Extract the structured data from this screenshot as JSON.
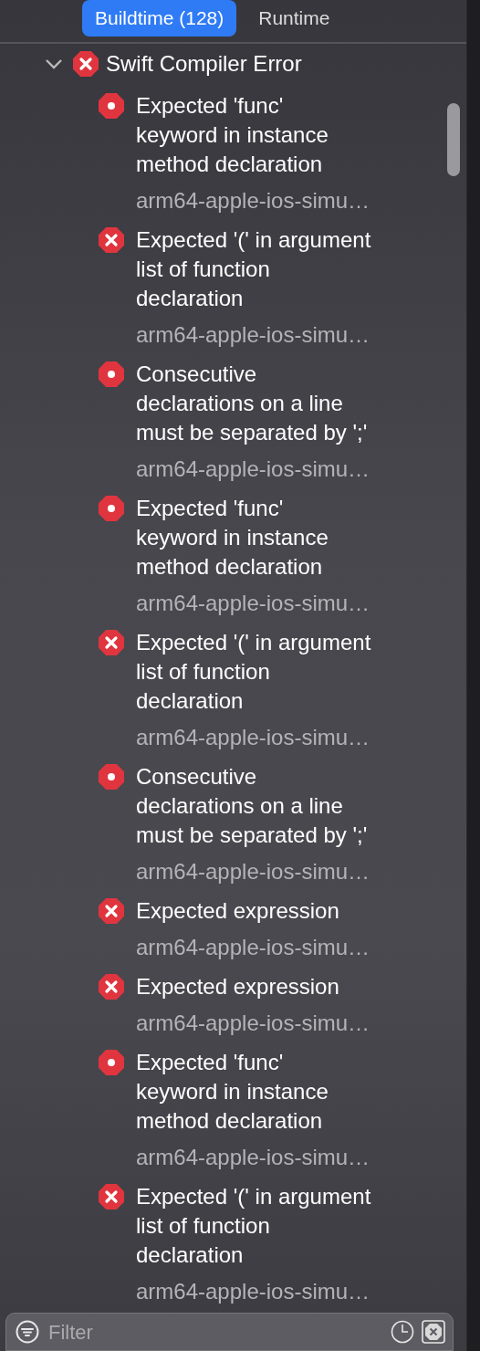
{
  "tabs": [
    {
      "label": "Buildtime (128)",
      "selected": true
    },
    {
      "label": "Runtime",
      "selected": false
    }
  ],
  "tree": {
    "label": "Swift Compiler Error",
    "kind": "x",
    "expanded": true,
    "children": [
      {
        "kind": "dot",
        "title_lines": [
          "Expected 'func'",
          "keyword in instance",
          "method declaration"
        ],
        "subtitle": "arm64-apple-ios-simu…"
      },
      {
        "kind": "x",
        "title_lines": [
          "Expected '(' in argument",
          "list of function",
          "declaration"
        ],
        "subtitle": "arm64-apple-ios-simu…"
      },
      {
        "kind": "dot",
        "title_lines": [
          "Consecutive",
          "declarations on a line",
          "must be separated by ';'"
        ],
        "subtitle": "arm64-apple-ios-simu…"
      },
      {
        "kind": "dot",
        "title_lines": [
          "Expected 'func'",
          "keyword in instance",
          "method declaration"
        ],
        "subtitle": "arm64-apple-ios-simu…"
      },
      {
        "kind": "x",
        "title_lines": [
          "Expected '(' in argument",
          "list of function",
          "declaration"
        ],
        "subtitle": "arm64-apple-ios-simu…"
      },
      {
        "kind": "dot",
        "title_lines": [
          "Consecutive",
          "declarations on a line",
          "must be separated by ';'"
        ],
        "subtitle": "arm64-apple-ios-simu…"
      },
      {
        "kind": "x",
        "title_lines": [
          "Expected expression"
        ],
        "subtitle": "arm64-apple-ios-simu…"
      },
      {
        "kind": "x",
        "title_lines": [
          "Expected expression"
        ],
        "subtitle": "arm64-apple-ios-simu…"
      },
      {
        "kind": "dot",
        "title_lines": [
          "Expected 'func'",
          "keyword in instance",
          "method declaration"
        ],
        "subtitle": "arm64-apple-ios-simu…"
      },
      {
        "kind": "x",
        "title_lines": [
          "Expected '(' in argument",
          "list of function",
          "declaration"
        ],
        "subtitle": "arm64-apple-ios-simu…"
      }
    ]
  },
  "filter": {
    "placeholder": "Filter"
  }
}
